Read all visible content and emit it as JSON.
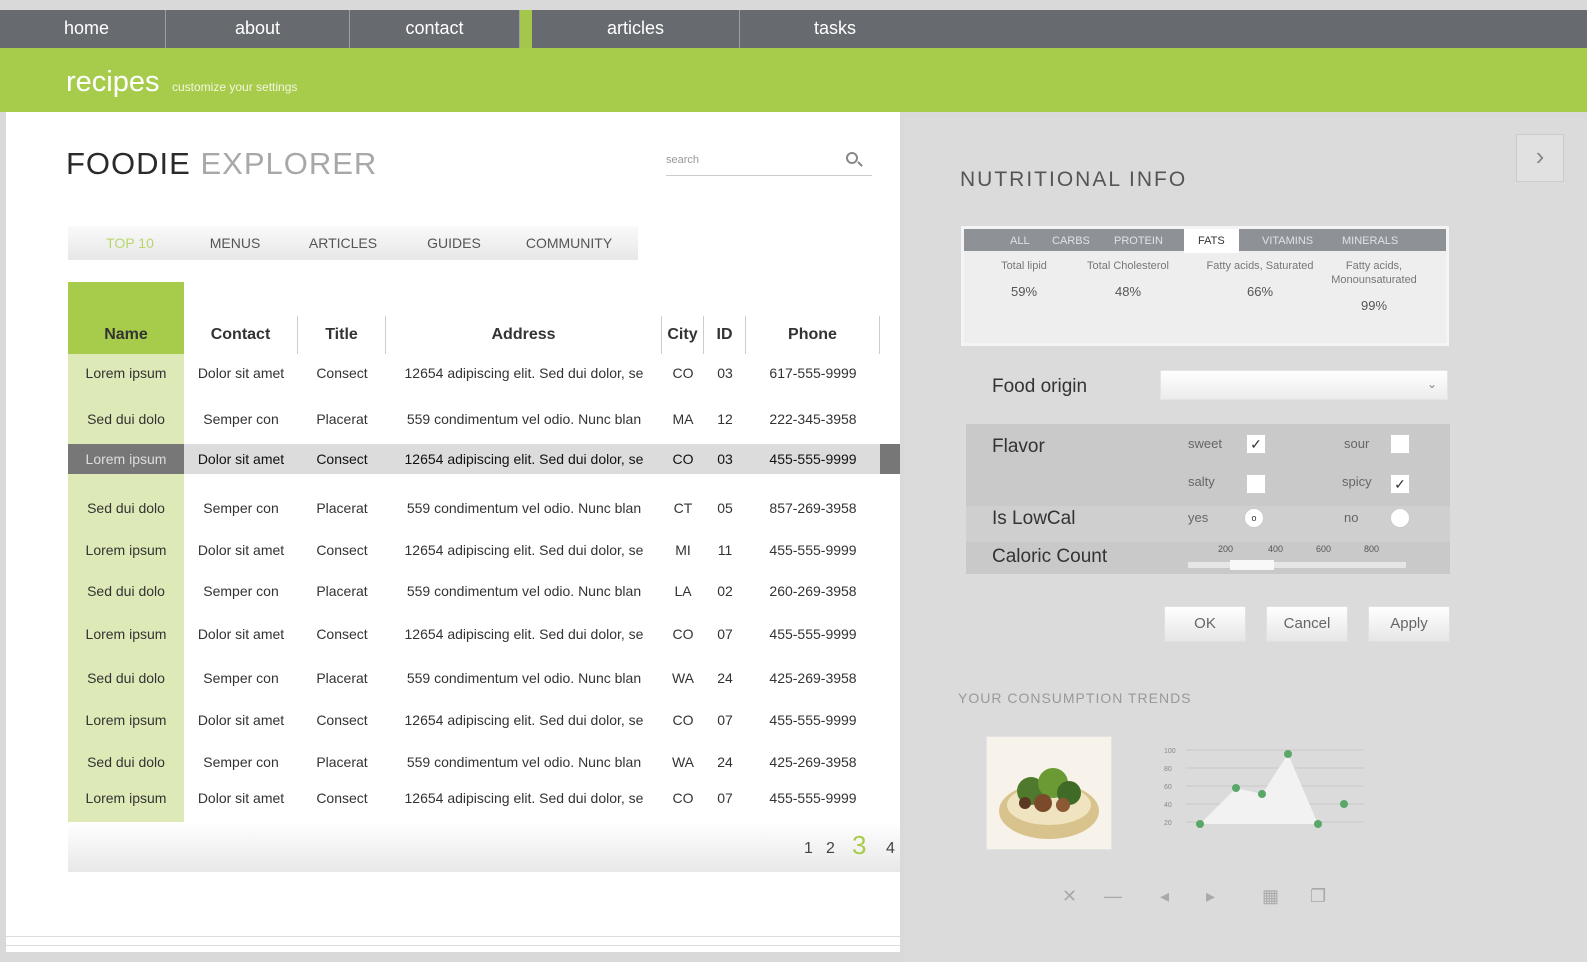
{
  "nav": {
    "items": [
      "home",
      "about",
      "contact",
      "articles",
      "tasks"
    ]
  },
  "header": {
    "title": "recipes",
    "subtitle": "customize your settings"
  },
  "left": {
    "brand_bold": "FOODIE",
    "brand_light": "EXPLORER",
    "search_placeholder": "search",
    "tabs": [
      "TOP 10",
      "MENUS",
      "ARTICLES",
      "GUIDES",
      "COMMUNITY"
    ],
    "table": {
      "columns": [
        "Name",
        "Contact",
        "Title",
        "Address",
        "City",
        "ID",
        "Phone"
      ],
      "rows": [
        [
          "Lorem ipsum",
          "Dolor sit amet",
          "Consect",
          "12654 adipiscing elit. Sed dui dolor, se",
          "CO",
          "03",
          "617-555-9999"
        ],
        [
          "Sed dui dolo",
          "Semper con",
          "Placerat",
          "559 condimentum vel odio. Nunc blan",
          "MA",
          "12",
          "222-345-3958"
        ],
        [
          "Lorem ipsum",
          "Dolor sit amet",
          "Consect",
          "12654 adipiscing elit. Sed dui dolor, se",
          "CO",
          "03",
          "455-555-9999"
        ],
        [
          "Sed dui dolo",
          "Semper con",
          "Placerat",
          "559 condimentum vel odio. Nunc blan",
          "CT",
          "05",
          "857-269-3958"
        ],
        [
          "Lorem ipsum",
          "Dolor sit amet",
          "Consect",
          "12654 adipiscing elit. Sed dui dolor, se",
          "MI",
          "11",
          "455-555-9999"
        ],
        [
          "Sed dui dolo",
          "Semper con",
          "Placerat",
          "559 condimentum vel odio. Nunc blan",
          "LA",
          "02",
          "260-269-3958"
        ],
        [
          "Lorem ipsum",
          "Dolor sit amet",
          "Consect",
          "12654 adipiscing elit. Sed dui dolor, se",
          "CO",
          "07",
          "455-555-9999"
        ],
        [
          "Sed dui dolo",
          "Semper con",
          "Placerat",
          "559 condimentum vel odio. Nunc blan",
          "WA",
          "24",
          "425-269-3958"
        ],
        [
          "Lorem ipsum",
          "Dolor sit amet",
          "Consect",
          "12654 adipiscing elit. Sed dui dolor, se",
          "CO",
          "07",
          "455-555-9999"
        ],
        [
          "Sed dui dolo",
          "Semper con",
          "Placerat",
          "559 condimentum vel odio. Nunc blan",
          "WA",
          "24",
          "425-269-3958"
        ],
        [
          "Lorem ipsum",
          "Dolor sit amet",
          "Consect",
          "12654 adipiscing elit. Sed dui dolor, se",
          "CO",
          "07",
          "455-555-9999"
        ]
      ],
      "selected_row": 2
    },
    "pagination": [
      "1",
      "2",
      "3",
      "4"
    ]
  },
  "right": {
    "title": "NUTRITIONAL INFO",
    "nutri_tabs": [
      "ALL",
      "CARBS",
      "PROTEIN",
      "FATS",
      "VITAMINS",
      "MINERALS"
    ],
    "nutri_active": "FATS",
    "nutri_cols": [
      {
        "label": "Total lipid",
        "value": "59%"
      },
      {
        "label": "Total Cholesterol",
        "value": "48%"
      },
      {
        "label": "Fatty acids, Saturated",
        "value": "66%"
      },
      {
        "label": "Fatty acids, Monounsaturated",
        "value": "99%"
      }
    ],
    "food_origin_label": "Food origin",
    "flavor_label": "Flavor",
    "flavor_options": {
      "sweet": "sweet",
      "sour": "sour",
      "salty": "salty",
      "spicy": "spicy"
    },
    "lowcal_label": "Is LowCal",
    "lowcal_yes": "yes",
    "lowcal_no": "no",
    "caloric_label": "Caloric Count",
    "caloric_ticks": [
      "200",
      "400",
      "600",
      "800"
    ],
    "buttons": {
      "ok": "OK",
      "cancel": "Cancel",
      "apply": "Apply"
    },
    "trend_title": "YOUR CONSUMPTION TRENDS",
    "trend_yaxis": [
      "100",
      "80",
      "60",
      "40",
      "20"
    ]
  },
  "colors": {
    "accent": "#a7cc4c",
    "nav": "#676b70"
  }
}
